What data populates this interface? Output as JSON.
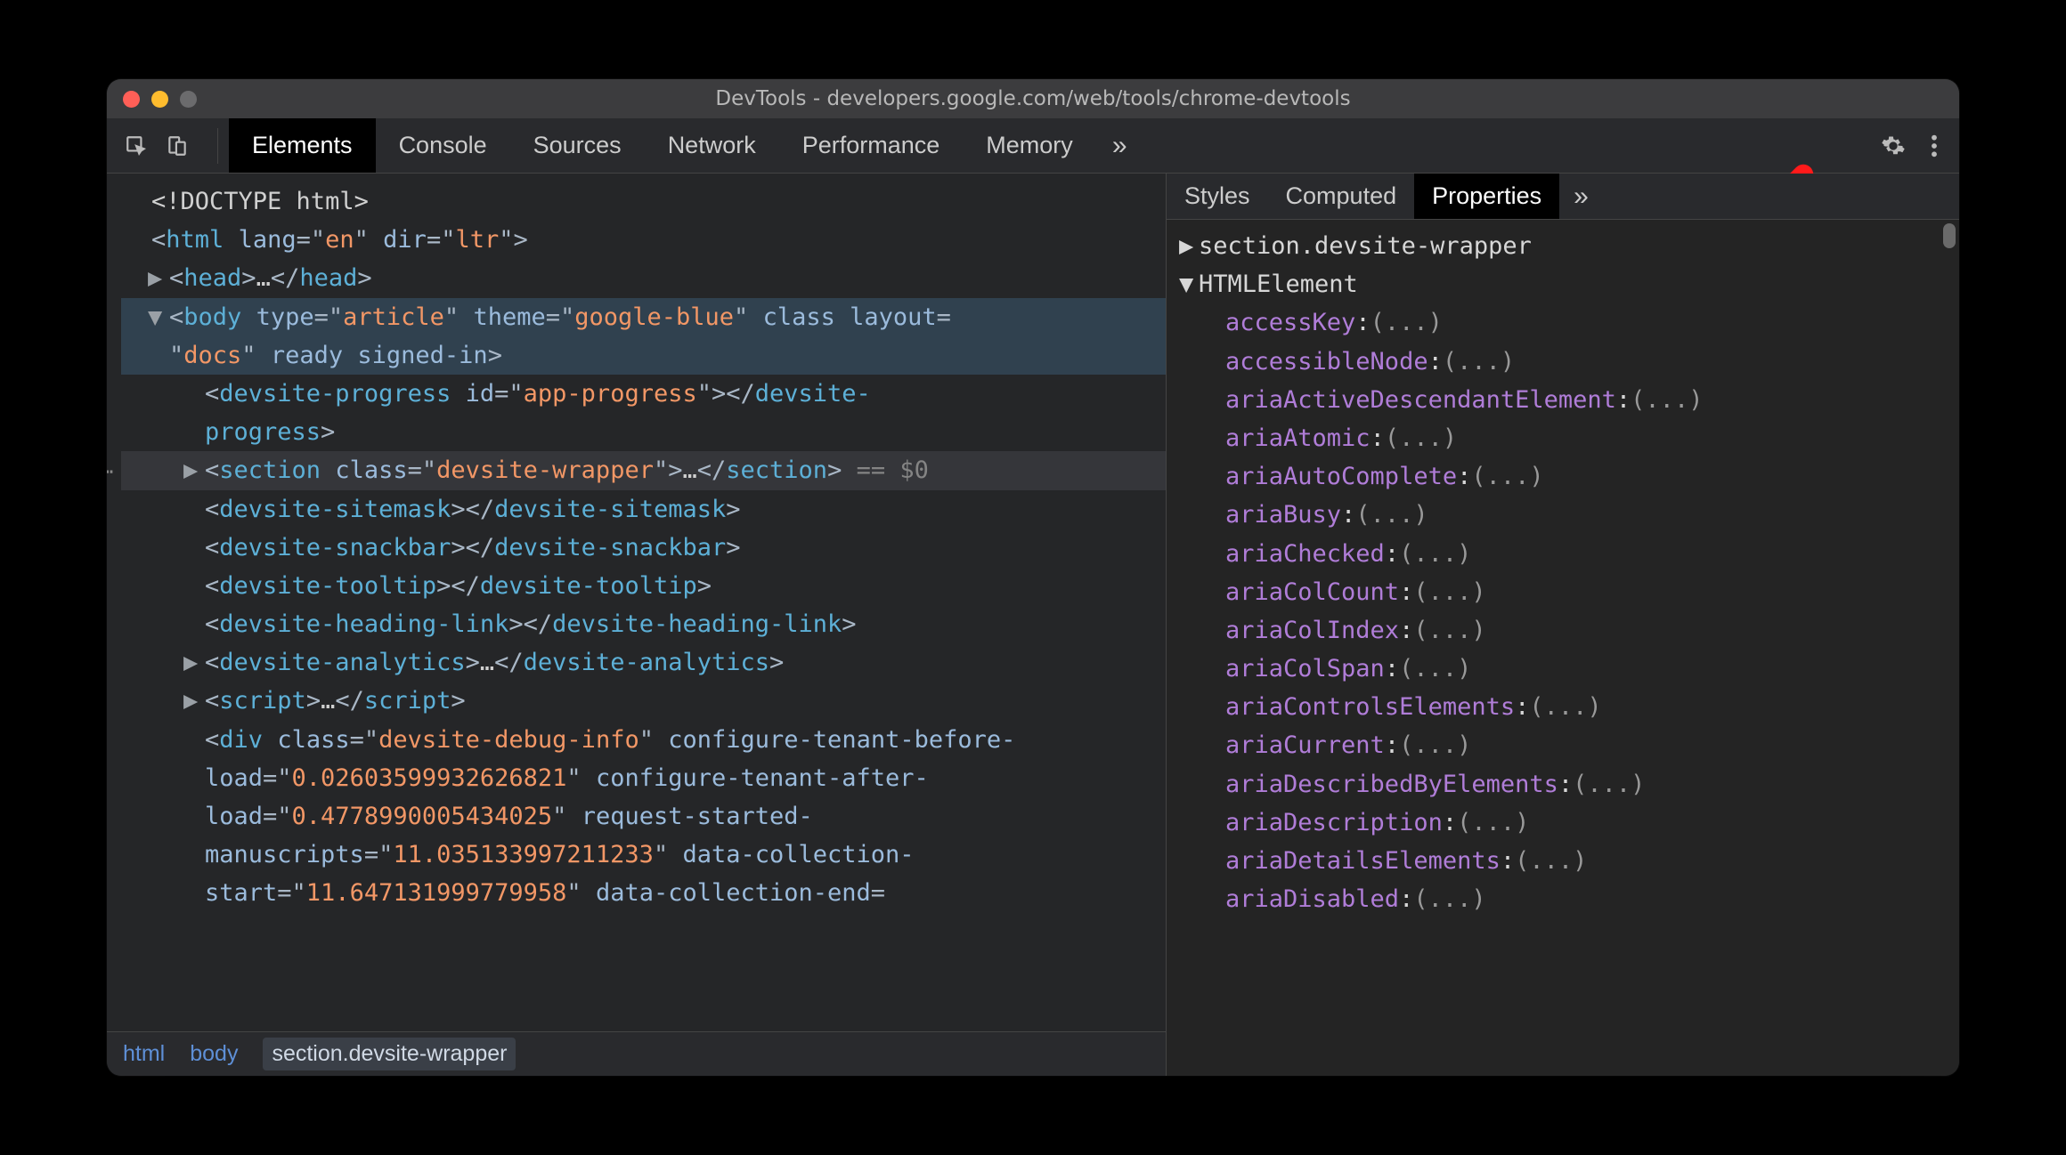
{
  "window": {
    "title": "DevTools - developers.google.com/web/tools/chrome-devtools"
  },
  "toolbar": {
    "tabs": [
      "Elements",
      "Console",
      "Sources",
      "Network",
      "Performance",
      "Memory"
    ],
    "more": "»",
    "active": 0
  },
  "dom": {
    "doctype": "<!DOCTYPE html>",
    "html_open": {
      "tag": "html",
      "attrs": [
        [
          "lang",
          "en"
        ],
        [
          "dir",
          "ltr"
        ]
      ]
    },
    "head": {
      "tag": "head"
    },
    "body_open": {
      "tag": "body",
      "attrs": [
        [
          "type",
          "article"
        ],
        [
          "theme",
          "google-blue"
        ]
      ],
      "bare": [
        "class",
        "layout"
      ],
      "bare2": [
        [
          "",
          "docs"
        ]
      ],
      "flags": [
        "ready",
        "signed-in"
      ]
    },
    "progress": {
      "tag": "devsite-progress",
      "attrs": [
        [
          "id",
          "app-progress"
        ]
      ]
    },
    "section": {
      "tag": "section",
      "attrs": [
        [
          "class",
          "devsite-wrapper"
        ]
      ],
      "suffix": "== $0"
    },
    "sitemask": {
      "tag": "devsite-sitemask"
    },
    "snackbar": {
      "tag": "devsite-snackbar"
    },
    "tooltip": {
      "tag": "devsite-tooltip"
    },
    "heading_link": {
      "tag": "devsite-heading-link"
    },
    "analytics": {
      "tag": "devsite-analytics"
    },
    "script": {
      "tag": "script"
    },
    "debug_div": {
      "tag": "div",
      "cls": "devsite-debug-info",
      "pairs": [
        [
          "configure-tenant-before-load",
          "0.02603599932626821"
        ],
        [
          "configure-tenant-after-load",
          "0.4778990005434025"
        ],
        [
          "request-started-manuscripts",
          "11.035133997211233"
        ],
        [
          "data-collection-start",
          "11.647131999779958"
        ]
      ],
      "trailing": "data-collection-end"
    }
  },
  "breadcrumb": [
    "html",
    "body",
    "section.devsite-wrapper"
  ],
  "side_tabs": {
    "tabs": [
      "Styles",
      "Computed",
      "Properties"
    ],
    "more": "»",
    "active": 2
  },
  "properties": {
    "header": "section.devsite-wrapper",
    "proto": "HTMLElement",
    "entries": [
      "accessKey",
      "accessibleNode",
      "ariaActiveDescendantElement",
      "ariaAtomic",
      "ariaAutoComplete",
      "ariaBusy",
      "ariaChecked",
      "ariaColCount",
      "ariaColIndex",
      "ariaColSpan",
      "ariaControlsElements",
      "ariaCurrent",
      "ariaDescribedByElements",
      "ariaDescription",
      "ariaDetailsElements",
      "ariaDisabled"
    ],
    "value_placeholder": "(...)"
  }
}
